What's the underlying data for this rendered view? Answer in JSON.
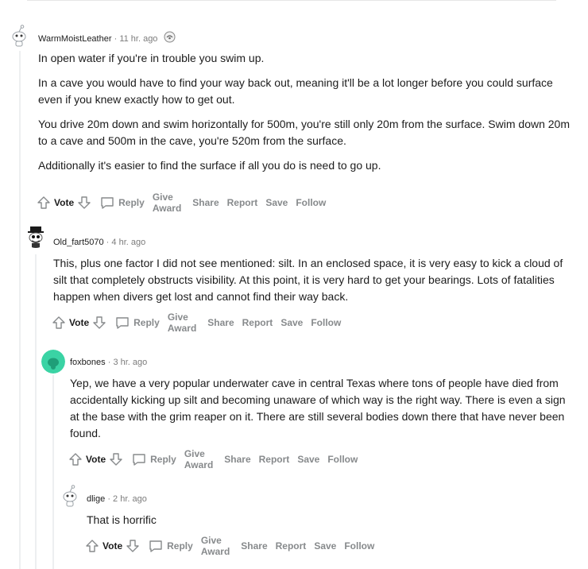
{
  "comments": [
    {
      "username": "WarmMoistLeather",
      "time": "11 hr. ago",
      "avatar_color": "#ffffff",
      "paragraphs": [
        "In open water if you're in trouble you swim up.",
        "In a cave you would have to find your way back out, meaning it'll be a lot longer before you could surface even if you knew exactly how to get out.",
        "You drive 20m down and swim horizontally for 500m, you're still only 20m from the surface. Swim down 20m to a cave and 500m in the cave, you're 520m from the surface.",
        "Additionally it's easier to find the surface if all you do is need to go up."
      ]
    },
    {
      "username": "Old_fart5070",
      "time": "4 hr. ago",
      "avatar_color": "#ffffff",
      "paragraphs": [
        "This, plus one factor I did not see mentioned: silt. In an enclosed space, it is very easy to kick a cloud of silt that completely obstructs visibility. At this point, it is very hard to get your bearings. Lots of fatalities happen when divers get lost and cannot find their way back."
      ]
    },
    {
      "username": "foxbones",
      "time": "3 hr. ago",
      "avatar_color": "#3ad3a4",
      "paragraphs": [
        "Yep, we have a very popular underwater cave in central Texas where tons of people have died from accidentally kicking up silt and becoming unaware of which way is the right way. There is even a sign at the base with the grim reaper on it. There are still several bodies down there that have never been found."
      ]
    },
    {
      "username": "dlige",
      "time": "2 hr. ago",
      "avatar_color": "#ffffff",
      "paragraphs": [
        "That is horrific"
      ]
    }
  ],
  "dot": "·",
  "actions": {
    "vote": "Vote",
    "reply": "Reply",
    "give_award": "Give Award",
    "share": "Share",
    "report": "Report",
    "save": "Save",
    "follow": "Follow"
  },
  "icons": {
    "upvote": "upvote-arrow-icon",
    "downvote": "downvote-arrow-icon",
    "reply": "comment-bubble-icon",
    "award": "award-badge-icon"
  }
}
